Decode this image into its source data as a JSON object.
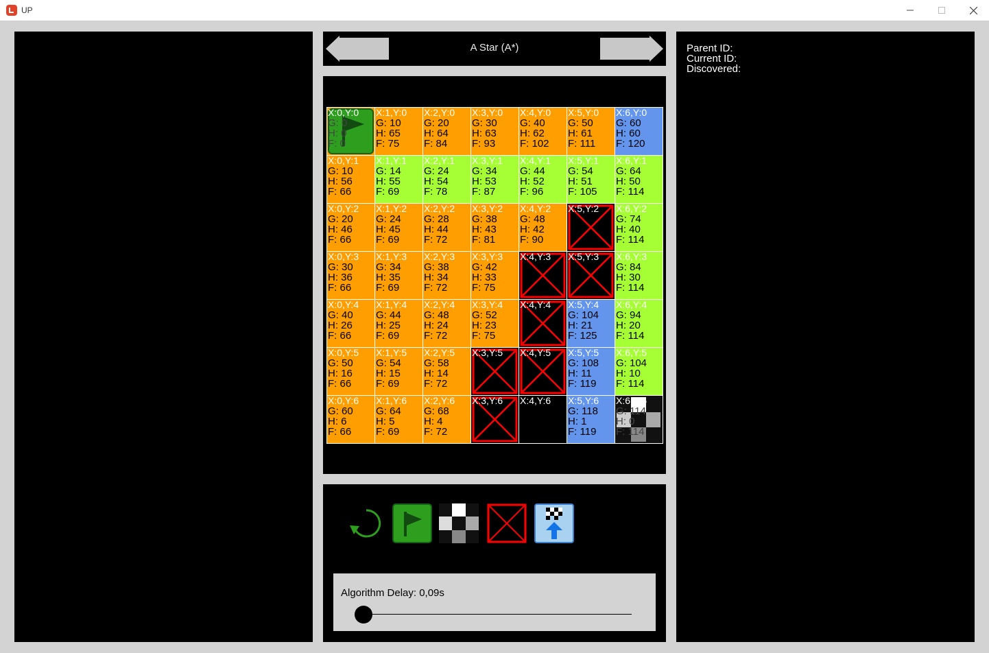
{
  "window": {
    "title": "UP"
  },
  "header": {
    "algorithm_name": "A Star (A*)"
  },
  "info": {
    "parent_label": "Parent ID:",
    "current_label": "Current ID:",
    "discovered_label": "Discovered:"
  },
  "slider": {
    "label": "Algorithm Delay: 0,09s",
    "value": 0.0
  },
  "colors": {
    "open": "#ff9e00",
    "closed": "#a6ff34",
    "path": "#6495ed",
    "empty": "#000000",
    "wall": "#ff0000",
    "start": "#2e9e1e"
  },
  "grid": {
    "cols": 7,
    "rows": [
      [
        {
          "label": "X:0,Y:0",
          "state": "start",
          "g": "G: 0",
          "h": "H: 0",
          "f": "F: 0"
        },
        {
          "label": "X:1,Y:0",
          "state": "open",
          "g": "G: 10",
          "h": "H: 65",
          "f": "F: 75"
        },
        {
          "label": "X:2,Y:0",
          "state": "open",
          "g": "G: 20",
          "h": "H: 64",
          "f": "F: 84"
        },
        {
          "label": "X:3,Y:0",
          "state": "open",
          "g": "G: 30",
          "h": "H: 63",
          "f": "F: 93"
        },
        {
          "label": "X:4,Y:0",
          "state": "open",
          "g": "G: 40",
          "h": "H: 62",
          "f": "F: 102"
        },
        {
          "label": "X:5,Y:0",
          "state": "open",
          "g": "G: 50",
          "h": "H: 61",
          "f": "F: 111"
        },
        {
          "label": "X:6,Y:0",
          "state": "path",
          "g": "G: 60",
          "h": "H: 60",
          "f": "F: 120"
        }
      ],
      [
        {
          "label": "X:0,Y:1",
          "state": "open",
          "g": "G: 10",
          "h": "H: 56",
          "f": "F: 66"
        },
        {
          "label": "X:1,Y:1",
          "state": "closed",
          "g": "G: 14",
          "h": "H: 55",
          "f": "F: 69"
        },
        {
          "label": "X:2,Y:1",
          "state": "closed",
          "g": "G: 24",
          "h": "H: 54",
          "f": "F: 78"
        },
        {
          "label": "X:3,Y:1",
          "state": "closed",
          "g": "G: 34",
          "h": "H: 53",
          "f": "F: 87"
        },
        {
          "label": "X:4,Y:1",
          "state": "closed",
          "g": "G: 44",
          "h": "H: 52",
          "f": "F: 96"
        },
        {
          "label": "X:5,Y:1",
          "state": "closed",
          "g": "G: 54",
          "h": "H: 51",
          "f": "F: 105"
        },
        {
          "label": "X:6,Y:1",
          "state": "closed",
          "g": "G: 64",
          "h": "H: 50",
          "f": "F: 114"
        }
      ],
      [
        {
          "label": "X:0,Y:2",
          "state": "open",
          "g": "G: 20",
          "h": "H: 46",
          "f": "F: 66"
        },
        {
          "label": "X:1,Y:2",
          "state": "open",
          "g": "G: 24",
          "h": "H: 45",
          "f": "F: 69"
        },
        {
          "label": "X:2,Y:2",
          "state": "open",
          "g": "G: 28",
          "h": "H: 44",
          "f": "F: 72"
        },
        {
          "label": "X:3,Y:2",
          "state": "open",
          "g": "G: 38",
          "h": "H: 43",
          "f": "F: 81"
        },
        {
          "label": "X:4,Y:2",
          "state": "open",
          "g": "G: 48",
          "h": "H: 42",
          "f": "F: 90"
        },
        {
          "label": "X:5,Y:2",
          "state": "wall",
          "g": "",
          "h": "",
          "f": ""
        },
        {
          "label": "X:6,Y:2",
          "state": "closed",
          "g": "G: 74",
          "h": "H: 40",
          "f": "F: 114"
        }
      ],
      [
        {
          "label": "X:0,Y:3",
          "state": "open",
          "g": "G: 30",
          "h": "H: 36",
          "f": "F: 66"
        },
        {
          "label": "X:1,Y:3",
          "state": "open",
          "g": "G: 34",
          "h": "H: 35",
          "f": "F: 69"
        },
        {
          "label": "X:2,Y:3",
          "state": "open",
          "g": "G: 38",
          "h": "H: 34",
          "f": "F: 72"
        },
        {
          "label": "X:3,Y:3",
          "state": "open",
          "g": "G: 42",
          "h": "H: 33",
          "f": "F: 75"
        },
        {
          "label": "X:4,Y:3",
          "state": "wall",
          "g": "",
          "h": "",
          "f": ""
        },
        {
          "label": "X:5,Y:3",
          "state": "wall",
          "g": "",
          "h": "",
          "f": ""
        },
        {
          "label": "X:6,Y:3",
          "state": "closed",
          "g": "G: 84",
          "h": "H: 30",
          "f": "F: 114"
        }
      ],
      [
        {
          "label": "X:0,Y:4",
          "state": "open",
          "g": "G: 40",
          "h": "H: 26",
          "f": "F: 66"
        },
        {
          "label": "X:1,Y:4",
          "state": "open",
          "g": "G: 44",
          "h": "H: 25",
          "f": "F: 69"
        },
        {
          "label": "X:2,Y:4",
          "state": "open",
          "g": "G: 48",
          "h": "H: 24",
          "f": "F: 72"
        },
        {
          "label": "X:3,Y:4",
          "state": "open",
          "g": "G: 52",
          "h": "H: 23",
          "f": "F: 75"
        },
        {
          "label": "X:4,Y:4",
          "state": "wall",
          "g": "",
          "h": "",
          "f": ""
        },
        {
          "label": "X:5,Y:4",
          "state": "path",
          "g": "G: 104",
          "h": "H: 21",
          "f": "F: 125"
        },
        {
          "label": "X:6,Y:4",
          "state": "closed",
          "g": "G: 94",
          "h": "H: 20",
          "f": "F: 114"
        }
      ],
      [
        {
          "label": "X:0,Y:5",
          "state": "open",
          "g": "G: 50",
          "h": "H: 16",
          "f": "F: 66"
        },
        {
          "label": "X:1,Y:5",
          "state": "open",
          "g": "G: 54",
          "h": "H: 15",
          "f": "F: 69"
        },
        {
          "label": "X:2,Y:5",
          "state": "open",
          "g": "G: 58",
          "h": "H: 14",
          "f": "F: 72"
        },
        {
          "label": "X:3,Y:5",
          "state": "wall",
          "g": "",
          "h": "",
          "f": ""
        },
        {
          "label": "X:4,Y:5",
          "state": "wall",
          "g": "",
          "h": "",
          "f": ""
        },
        {
          "label": "X:5,Y:5",
          "state": "path",
          "g": "G: 108",
          "h": "H: 11",
          "f": "F: 119"
        },
        {
          "label": "X:6,Y:5",
          "state": "closed",
          "g": "G: 104",
          "h": "H: 10",
          "f": "F: 114"
        }
      ],
      [
        {
          "label": "X:0,Y:6",
          "state": "open",
          "g": "G: 60",
          "h": "H: 6",
          "f": "F: 66"
        },
        {
          "label": "X:1,Y:6",
          "state": "open",
          "g": "G: 64",
          "h": "H: 5",
          "f": "F: 69"
        },
        {
          "label": "X:2,Y:6",
          "state": "open",
          "g": "G: 68",
          "h": "H: 4",
          "f": "F: 72"
        },
        {
          "label": "X:3,Y:6",
          "state": "wall",
          "g": "",
          "h": "",
          "f": ""
        },
        {
          "label": "X:4,Y:6",
          "state": "empty",
          "g": "",
          "h": "",
          "f": ""
        },
        {
          "label": "X:5,Y:6",
          "state": "path",
          "g": "G: 118",
          "h": "H: 1",
          "f": "F: 119"
        },
        {
          "label": "X:6,Y:6",
          "state": "goal",
          "g": "G: 114",
          "h": "H: 0",
          "f": "F: 114"
        }
      ]
    ]
  },
  "tools": [
    {
      "name": "reset-icon"
    },
    {
      "name": "start-flag-icon"
    },
    {
      "name": "goal-checker-icon"
    },
    {
      "name": "wall-icon"
    },
    {
      "name": "upload-checker-icon"
    }
  ]
}
